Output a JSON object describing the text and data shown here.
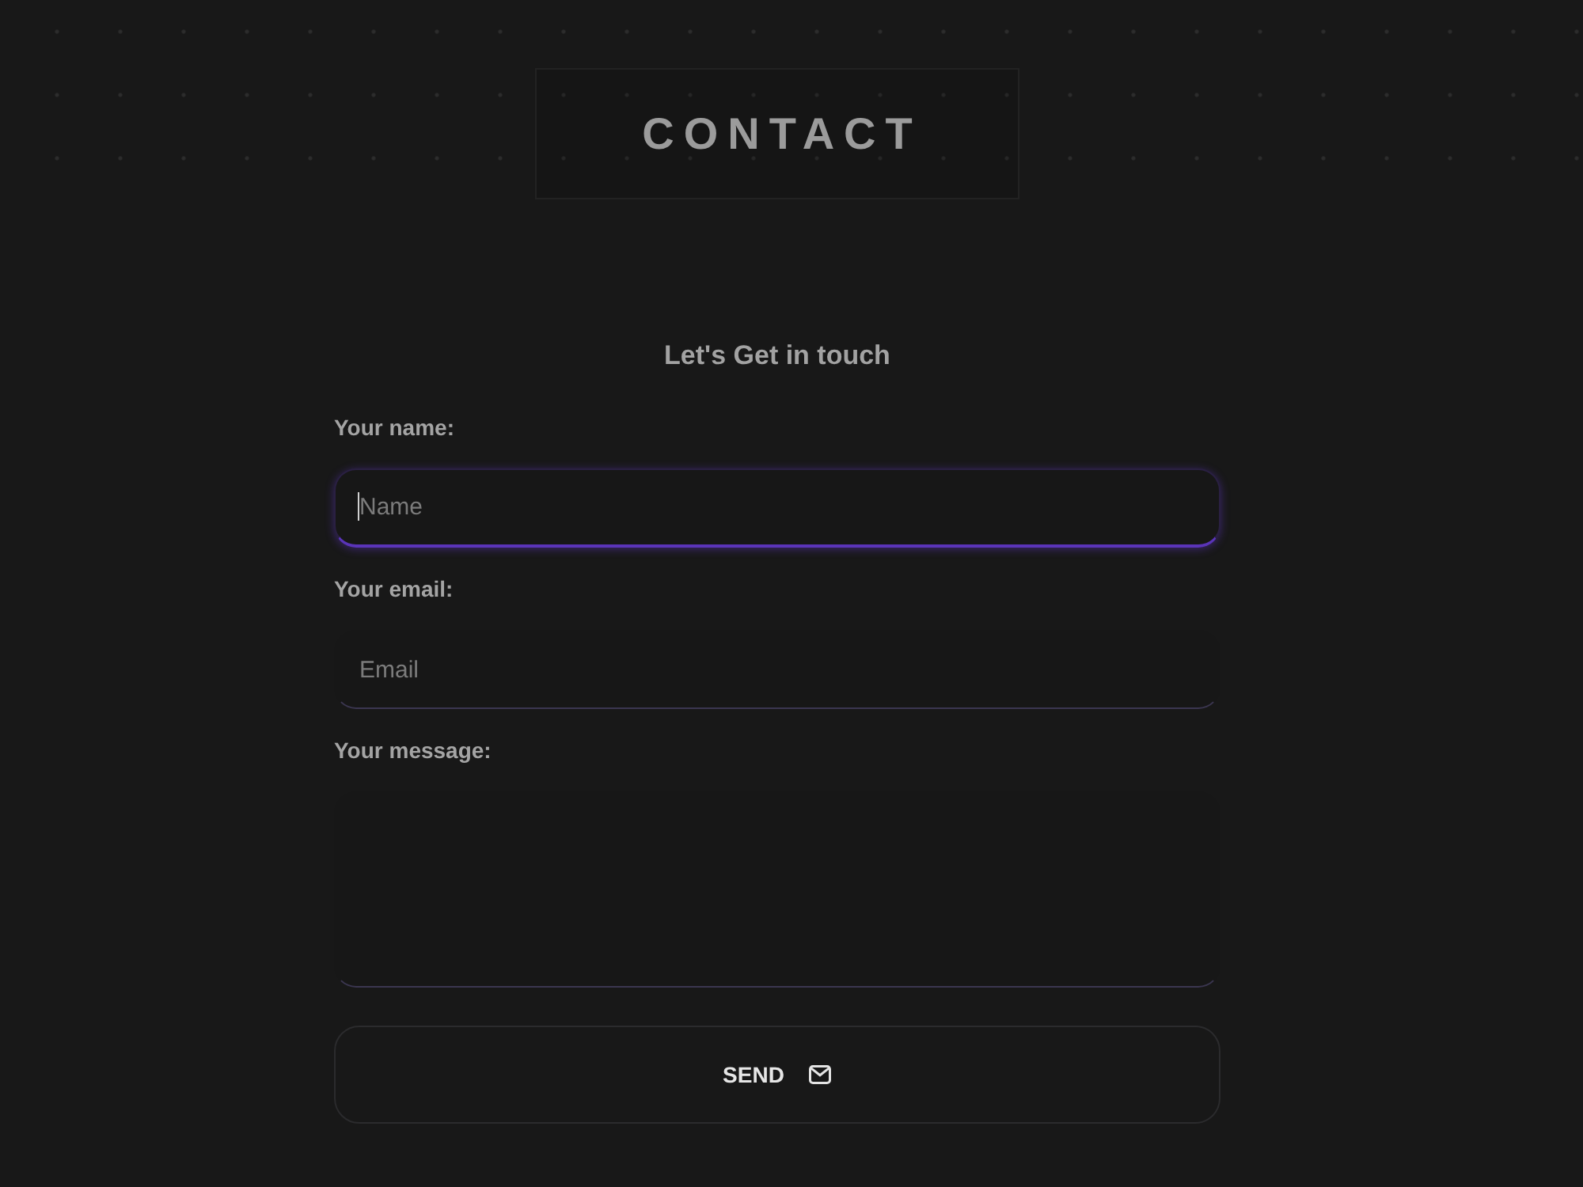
{
  "header": {
    "title": "CONTACT"
  },
  "form": {
    "heading": "Let's Get in touch",
    "fields": [
      {
        "kind": "input",
        "label": "Your name:",
        "placeholder": "Name",
        "focused": true
      },
      {
        "kind": "input",
        "label": "Your email:",
        "placeholder": "Email",
        "focused": false
      },
      {
        "kind": "textarea",
        "label": "Your message:",
        "focused": false
      }
    ],
    "submit": {
      "label": "SEND"
    }
  }
}
